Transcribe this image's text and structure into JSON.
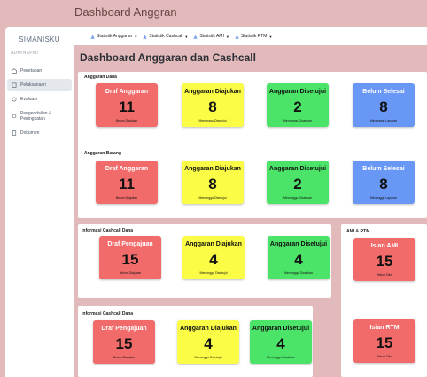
{
  "window": {
    "title": "Dashboard Anggran"
  },
  "sidebar": {
    "brand": "SIMANISKU",
    "role": "ADMINSPMI",
    "items": [
      {
        "label": "Penetapan",
        "icon": "building-icon"
      },
      {
        "label": "Pelaksanaan",
        "icon": "clipboard-icon",
        "active": true
      },
      {
        "label": "Evaluasi",
        "icon": "refresh-icon"
      },
      {
        "label": "Pengendalian & Peningkatan",
        "icon": "gear-icon"
      },
      {
        "label": "Dokumen",
        "icon": "document-icon"
      }
    ]
  },
  "tabs": [
    {
      "label": "Statistik Anggaran"
    },
    {
      "label": "Statistik Cashcall"
    },
    {
      "label": "Statistik AMI"
    },
    {
      "label": "Statistik RTM"
    }
  ],
  "main": {
    "title": "Dashboard Anggaran dan Cashcall"
  },
  "sections": {
    "anggaran_dana": {
      "title": "Anggaran Dana",
      "cards": [
        {
          "title": "Draf Anggaran",
          "value": "11",
          "sub": "Belum Diajukan"
        },
        {
          "title": "Anggaran Diajukan",
          "value": "8",
          "sub": "Menunggu Disetujui"
        },
        {
          "title": "Anggaran Disetujui",
          "value": "2",
          "sub": "Menunggu Dicairkan"
        },
        {
          "title": "Belum Selesai",
          "value": "8",
          "sub": "Menunggu Laporan"
        }
      ]
    },
    "anggaran_barang": {
      "title": "Anggaran Barang",
      "cards": [
        {
          "title": "Draf Anggaran",
          "value": "11",
          "sub": "Belum Diajukan"
        },
        {
          "title": "Anggaran Diajukan",
          "value": "8",
          "sub": "Menunggu Disetujui"
        },
        {
          "title": "Anggaran Disetujui",
          "value": "2",
          "sub": "Menunggu Dicairkan"
        },
        {
          "title": "Belum Selesai",
          "value": "8",
          "sub": "Menunggu Laporan"
        }
      ]
    },
    "cashcall_dana_1": {
      "title": "Informasi Cashcall Dana",
      "cards": [
        {
          "title": "Draf Pengajuan",
          "value": "15",
          "sub": "Belum Diajukan"
        },
        {
          "title": "Anggaran Diajukan",
          "value": "4",
          "sub": "Menunggu Disetujui"
        },
        {
          "title": "Anggaran Disetujui",
          "value": "4",
          "sub": "Menunggu Dicairkan"
        }
      ]
    },
    "cashcall_dana_2": {
      "title": "Informasi Cashcall Dana",
      "cards": [
        {
          "title": "Draf Pengajuan",
          "value": "15",
          "sub": "Belum Diajukan"
        },
        {
          "title": "Anggaran Diajukan",
          "value": "4",
          "sub": "Menunggu Disetujui"
        },
        {
          "title": "Anggaran Disetujui",
          "value": "4",
          "sub": "Menunggu Dicairkan"
        }
      ]
    },
    "ami_rtm": {
      "title": "AMI & RTM",
      "cards": [
        {
          "title": "Isian AMI",
          "value": "15",
          "sub": "Belum Diisi"
        },
        {
          "title": "Isian RTM",
          "value": "15",
          "sub": "Belum Diisi"
        }
      ]
    }
  },
  "colors": {
    "red": "#f16b6b",
    "yellow": "#fafc45",
    "green": "#4ce468",
    "blue": "#6897f5",
    "background": "#e2babb"
  }
}
